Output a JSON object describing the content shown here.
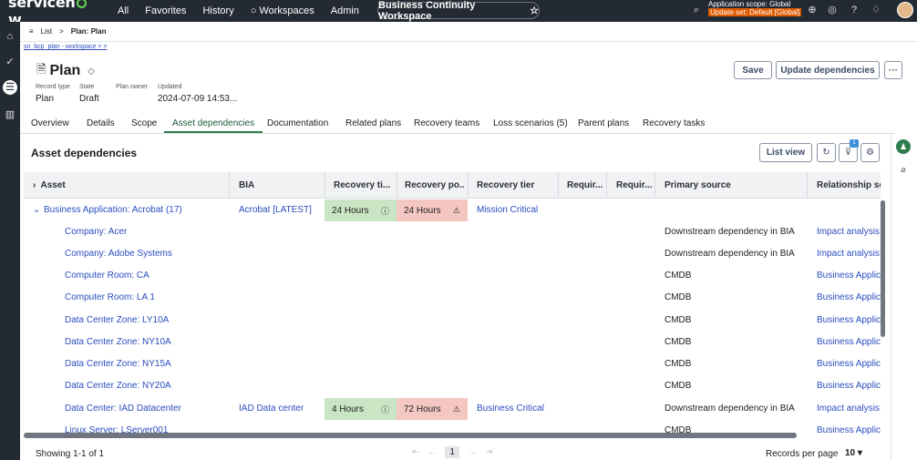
{
  "topnav": {
    "logo": "servicenow",
    "items": [
      "All",
      "Favorites",
      "History",
      "Workspaces",
      "Admin"
    ],
    "workspace_title": "Business Continuity Workspace",
    "scope_line1": "Application scope: Global",
    "scope_line2": "Update set: Default [Global]"
  },
  "breadcrumb": {
    "list": "List",
    "current": "Plan: Plan",
    "link": "sn_bcp_plan - workspace > >"
  },
  "record": {
    "title": "Plan",
    "fields": [
      {
        "label": "Record type",
        "value": "Plan"
      },
      {
        "label": "State",
        "value": "Draft"
      },
      {
        "label": "Plan owner",
        "value": ""
      },
      {
        "label": "Updated",
        "value": "2024-07-09 14:53..."
      }
    ],
    "save_label": "Save",
    "update_label": "Update dependencies",
    "more_label": "···"
  },
  "tabs": [
    "Overview",
    "Details",
    "Scope",
    "Asset dependencies",
    "Documentation",
    "Related plans",
    "Recovery teams",
    "Loss scenarios (5)",
    "Parent plans",
    "Recovery tasks"
  ],
  "section": {
    "title": "Asset dependencies",
    "list_view_label": "List view",
    "filter_count": "1"
  },
  "table": {
    "headers": [
      "Asset",
      "BIA",
      "Recovery ti...",
      "Recovery po...",
      "Recovery tier",
      "Requir...",
      "Requir...",
      "Primary source",
      "Relationship sou"
    ],
    "rows": [
      {
        "asset": "Business Application: Acrobat (17)",
        "bia": "Acrobat [LATEST]",
        "rto": "24 Hours",
        "rpo": "24 Hours",
        "tier": "Mission Critical",
        "source": "",
        "rel": ""
      },
      {
        "asset": "Company: Acer",
        "bia": "",
        "rto": "",
        "rpo": "",
        "tier": "",
        "source": "Downstream dependency in BIA",
        "rel": "Impact analysis:"
      },
      {
        "asset": "Company: Adobe Systems",
        "bia": "",
        "rto": "",
        "rpo": "",
        "tier": "",
        "source": "Downstream dependency in BIA",
        "rel": "Impact analysis:"
      },
      {
        "asset": "Computer Room: CA",
        "bia": "",
        "rto": "",
        "rpo": "",
        "tier": "",
        "source": "CMDB",
        "rel": "Business Applica"
      },
      {
        "asset": "Computer Room: LA 1",
        "bia": "",
        "rto": "",
        "rpo": "",
        "tier": "",
        "source": "CMDB",
        "rel": "Business Applica"
      },
      {
        "asset": "Data Center Zone: LY10A",
        "bia": "",
        "rto": "",
        "rpo": "",
        "tier": "",
        "source": "CMDB",
        "rel": "Business Applica"
      },
      {
        "asset": "Data Center Zone: NY10A",
        "bia": "",
        "rto": "",
        "rpo": "",
        "tier": "",
        "source": "CMDB",
        "rel": "Business Applica"
      },
      {
        "asset": "Data Center Zone: NY15A",
        "bia": "",
        "rto": "",
        "rpo": "",
        "tier": "",
        "source": "CMDB",
        "rel": "Business Applica"
      },
      {
        "asset": "Data Center Zone: NY20A",
        "bia": "",
        "rto": "",
        "rpo": "",
        "tier": "",
        "source": "CMDB",
        "rel": "Business Applica"
      },
      {
        "asset": "Data Center: IAD Datacenter",
        "bia": "IAD Data center",
        "rto": "4 Hours",
        "rpo": "72 Hours",
        "tier": "Business Critical",
        "source": "Downstream dependency in BIA",
        "rel": "Impact analysis:"
      },
      {
        "asset": "Linux Server: LServer001",
        "bia": "",
        "rto": "",
        "rpo": "",
        "tier": "",
        "source": "CMDB",
        "rel": "Business Applica"
      }
    ]
  },
  "footer": {
    "showing": "Showing 1-1 of 1",
    "page": "1",
    "rpp_label": "Records per page",
    "rpp_value": "10 ▾"
  }
}
